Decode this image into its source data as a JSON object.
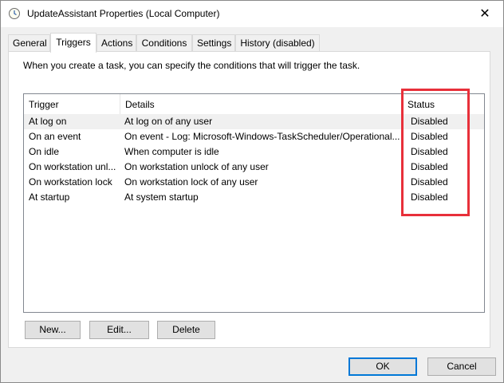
{
  "window": {
    "title": "UpdateAssistant Properties (Local Computer)",
    "close_glyph": "✕"
  },
  "tabs": [
    {
      "label": "General"
    },
    {
      "label": "Triggers",
      "active": true
    },
    {
      "label": "Actions"
    },
    {
      "label": "Conditions"
    },
    {
      "label": "Settings"
    },
    {
      "label": "History (disabled)"
    }
  ],
  "description": "When you create a task, you can specify the conditions that will trigger the task.",
  "table": {
    "columns": [
      "Trigger",
      "Details",
      "Status"
    ],
    "rows": [
      {
        "trigger": "At log on",
        "details": "At log on of any user",
        "status": "Disabled"
      },
      {
        "trigger": "On an event",
        "details": "On event - Log: Microsoft-Windows-TaskScheduler/Operational...",
        "status": "Disabled"
      },
      {
        "trigger": "On idle",
        "details": "When computer is idle",
        "status": "Disabled"
      },
      {
        "trigger": "On workstation unl...",
        "details": "On workstation unlock of any user",
        "status": "Disabled"
      },
      {
        "trigger": "On workstation lock",
        "details": "On workstation lock of any user",
        "status": "Disabled"
      },
      {
        "trigger": "At startup",
        "details": "At system startup",
        "status": "Disabled"
      }
    ]
  },
  "buttons": {
    "new": "New...",
    "edit": "Edit...",
    "delete": "Delete",
    "ok": "OK",
    "cancel": "Cancel"
  },
  "icons": {
    "title": "clock-icon"
  },
  "colors": {
    "highlight": "#e8303a",
    "default_button_border": "#0078d7"
  }
}
